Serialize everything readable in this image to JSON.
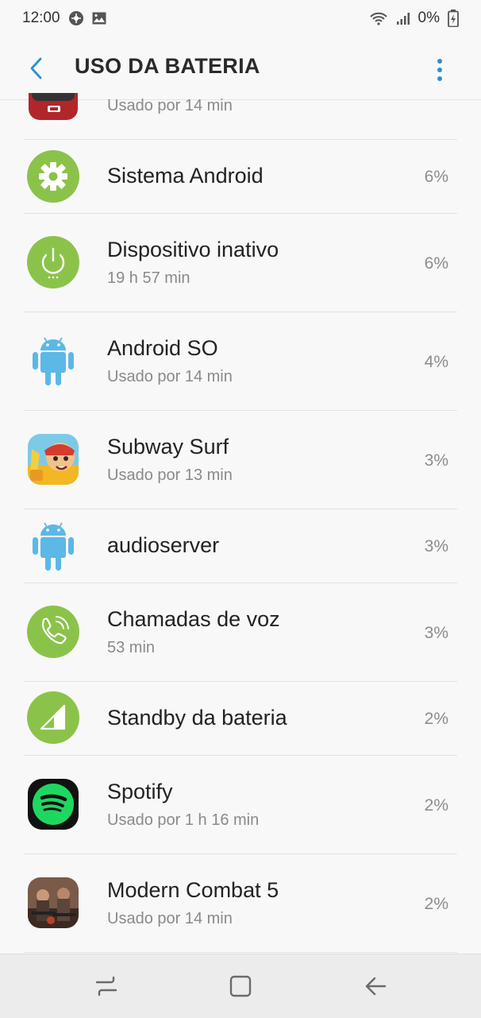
{
  "status": {
    "time": "12:00",
    "battery_percent": "0%",
    "icons": [
      "bug-icon",
      "image-notification-icon",
      "wifi-icon",
      "signal-icon",
      "battery-icon"
    ]
  },
  "header": {
    "title": "USO DA BATERIA",
    "back_icon": "back-arrow-icon",
    "more_icon": "more-vert-icon"
  },
  "list": {
    "partial": {
      "subtitle": "Usado por 14 min"
    },
    "items": [
      {
        "name": "Sistema Android",
        "subtitle": "",
        "percent": "6%",
        "icon": "settings-gear-icon"
      },
      {
        "name": "Dispositivo inativo",
        "subtitle": "19 h 57 min",
        "percent": "6%",
        "icon": "power-icon"
      },
      {
        "name": "Android SO",
        "subtitle": "Usado por 14 min",
        "percent": "4%",
        "icon": "android-icon"
      },
      {
        "name": "Subway Surf",
        "subtitle": "Usado por 13 min",
        "percent": "3%",
        "icon": "subway-surf-app-icon"
      },
      {
        "name": "audioserver",
        "subtitle": "",
        "percent": "3%",
        "icon": "android-icon"
      },
      {
        "name": "Chamadas de voz",
        "subtitle": "53 min",
        "percent": "3%",
        "icon": "phone-call-icon"
      },
      {
        "name": "Standby da bateria",
        "subtitle": "",
        "percent": "2%",
        "icon": "cell-signal-icon"
      },
      {
        "name": "Spotify",
        "subtitle": "Usado por 1 h 16 min",
        "percent": "2%",
        "icon": "spotify-icon"
      },
      {
        "name": "Modern Combat 5",
        "subtitle": "Usado por 14 min",
        "percent": "2%",
        "icon": "modern-combat-app-icon"
      }
    ]
  },
  "nav": {
    "recents_icon": "recents-icon",
    "home_icon": "home-icon",
    "back_icon": "back-icon"
  },
  "colors": {
    "green": "#8bc34a",
    "android_blue": "#5cb8e6",
    "accent": "#2e8fd0",
    "spotify_green": "#1ed760"
  }
}
